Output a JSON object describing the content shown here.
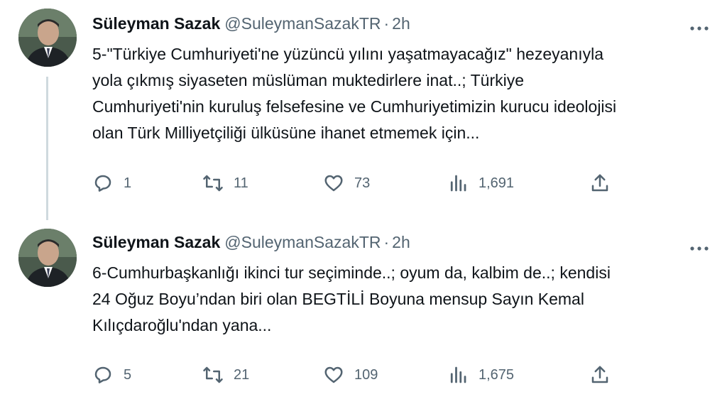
{
  "tweets": [
    {
      "author_name": "Süleyman Sazak",
      "handle": "@SuleymanSazakTR",
      "separator": "·",
      "time": "2h",
      "lines": [
        "5-\"Türkiye Cumhuriyeti'ne yüzüncü yılını yaşatmayacağız\" hezeyanıyla",
        "yola çıkmış siyaseten müslüman muktedirlere inat..; Türkiye",
        "Cumhuriyeti'nin kuruluş felsefesine ve Cumhuriyetimizin kurucu ideolojisi",
        "olan Türk Milliyetçiliği  ülküsüne ihanet etmemek için..."
      ],
      "replies": "1",
      "retweets": "11",
      "likes": "73",
      "views": "1,691"
    },
    {
      "author_name": "Süleyman Sazak",
      "handle": "@SuleymanSazakTR",
      "separator": "·",
      "time": "2h",
      "lines": [
        "6-Cumhurbaşkanlığı ikinci tur seçiminde..; oyum da, kalbim de..; kendisi",
        "24 Oğuz Boyu’ndan biri olan  BEGTİLİ Boyuna mensup Sayın Kemal",
        "Kılıçdaroğlu'ndan yana..."
      ],
      "replies": "5",
      "retweets": "21",
      "likes": "109",
      "views": "1,675"
    }
  ],
  "icons": {
    "reply": "reply-icon",
    "retweet": "retweet-icon",
    "like": "heart-icon",
    "views": "views-chart-icon",
    "share": "share-icon",
    "more": "more-dots-icon"
  },
  "colors": {
    "text": "#0f1419",
    "secondary": "#536471",
    "thread_line": "#cfd9de"
  }
}
